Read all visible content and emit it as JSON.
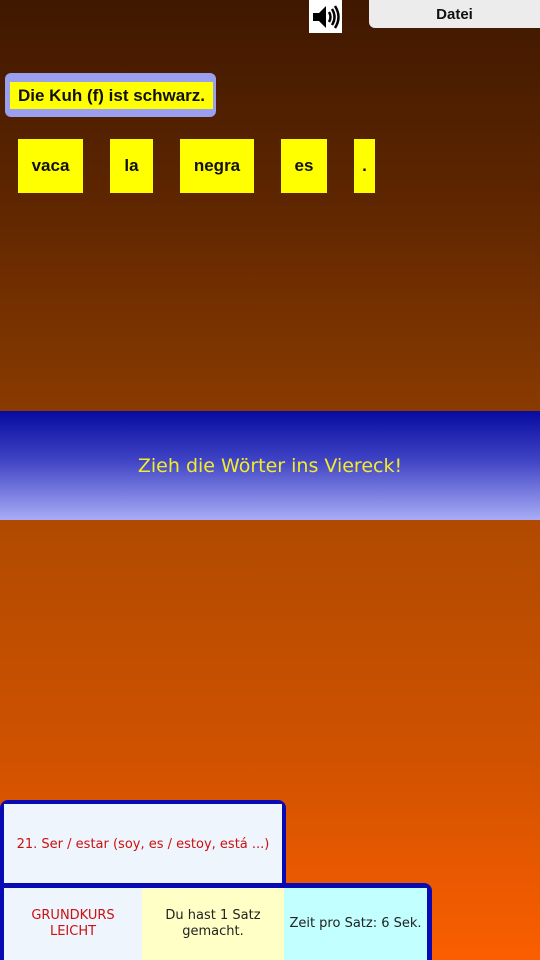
{
  "toolbar": {
    "speaker_icon": "speaker-icon",
    "file_label": "Datei"
  },
  "prompt": {
    "sentence": "Die Kuh (f) ist schwarz."
  },
  "words": [
    "vaca",
    "la",
    "negra",
    "es",
    "."
  ],
  "dropzone": {
    "instruction": "Zieh die Wörter ins Viereck!"
  },
  "lesson": {
    "title": "21. Ser / estar (soy, es / estoy, está ...)"
  },
  "status": {
    "course_line1": "GRUNDKURS",
    "course_line2": "LEICHT",
    "progress_line1": "Du hast 1 Satz",
    "progress_line2": "gemacht.",
    "time_per_sentence": "Zeit pro Satz: 6 Sek."
  },
  "colors": {
    "word_tile": "#ffff00",
    "panel_border": "#0a0ab5",
    "instruction_text": "#f2ec2a",
    "lesson_text": "#cc1010"
  }
}
